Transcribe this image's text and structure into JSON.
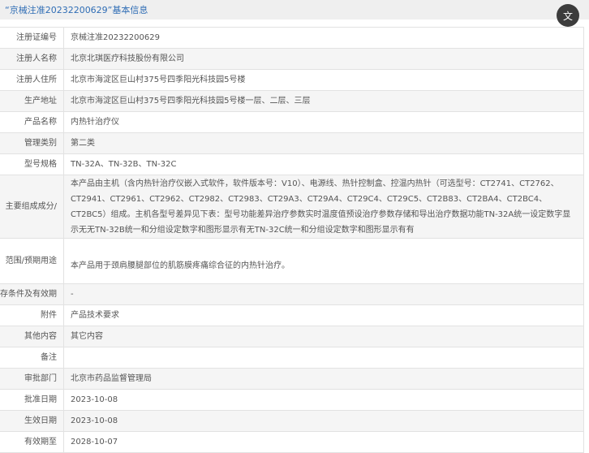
{
  "header": {
    "title": "“京械注准20232200629”基本信息",
    "translate_icon": "文"
  },
  "rows": [
    {
      "label": "注册证编号",
      "value": "京械注准20232200629"
    },
    {
      "label": "注册人名称",
      "value": "北京北琪医疗科技股份有限公司"
    },
    {
      "label": "注册人住所",
      "value": "北京市海淀区巨山村375号四季阳光科技园5号楼"
    },
    {
      "label": "生产地址",
      "value": "北京市海淀区巨山村375号四季阳光科技园5号楼一层、二层、三层"
    },
    {
      "label": "产品名称",
      "value": "内热针治疗仪"
    },
    {
      "label": "管理类别",
      "value": "第二类"
    },
    {
      "label": "型号规格",
      "value": "TN-32A、TN-32B、TN-32C"
    },
    {
      "label": "/主要组成成分",
      "value": "本产品由主机（含内热针治疗仪嵌入式软件，软件版本号：V10）、电源线、热针控制盒、控温内热针（可选型号：CT2741、CT2762、CT2941、CT2961、CT2962、CT2982、CT2983、CT29A3、CT29A4、CT29C4、CT29C5、CT2B83、CT2BA4、CT2BC4、CT2BC5）组成。主机各型号差异见下表：型号功能差异治疗参数实时温度值预设治疗参数存储和导出治疗数据功能TN-32A统一设定数字显示无无TN-32B统一和分组设定数字和图形显示有无TN-32C统一和分组设定数字和图形显示有有"
    },
    {
      "label": "范围/预期用途",
      "value": "本产品用于颈肩腰腿部位的肌筋膜疼痛综合征的内热针治疗。"
    },
    {
      "label": "存条件及有效期",
      "value": "-"
    },
    {
      "label": "附件",
      "value": "产品技术要求"
    },
    {
      "label": "其他内容",
      "value": "其它内容"
    },
    {
      "label": "备注",
      "value": ""
    },
    {
      "label": "审批部门",
      "value": "北京市药品监督管理局"
    },
    {
      "label": "批准日期",
      "value": "2023-10-08"
    },
    {
      "label": "生效日期",
      "value": "2023-10-08"
    },
    {
      "label": "有效期至",
      "value": "2028-10-07"
    }
  ]
}
